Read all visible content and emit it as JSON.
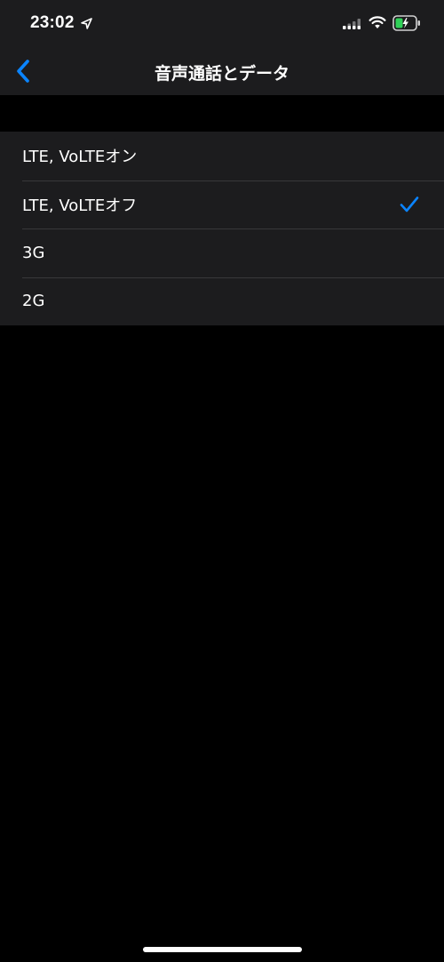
{
  "status_bar": {
    "time": "23:02",
    "location_icon": "location-arrow-icon",
    "signal_icon": "cellular-signal-icon",
    "wifi_icon": "wifi-icon",
    "battery_icon": "battery-charging-icon"
  },
  "nav": {
    "back_icon": "chevron-left-icon",
    "title": "音声通話とデータ"
  },
  "options": [
    {
      "label": "LTE, VoLTEオン",
      "selected": false
    },
    {
      "label": "LTE, VoLTEオフ",
      "selected": true
    },
    {
      "label": "3G",
      "selected": false
    },
    {
      "label": "2G",
      "selected": false
    }
  ],
  "colors": {
    "accent": "#0a84ff",
    "background": "#000000",
    "surface": "#1c1c1e",
    "separator": "#38383a",
    "battery_fill": "#30d158"
  }
}
